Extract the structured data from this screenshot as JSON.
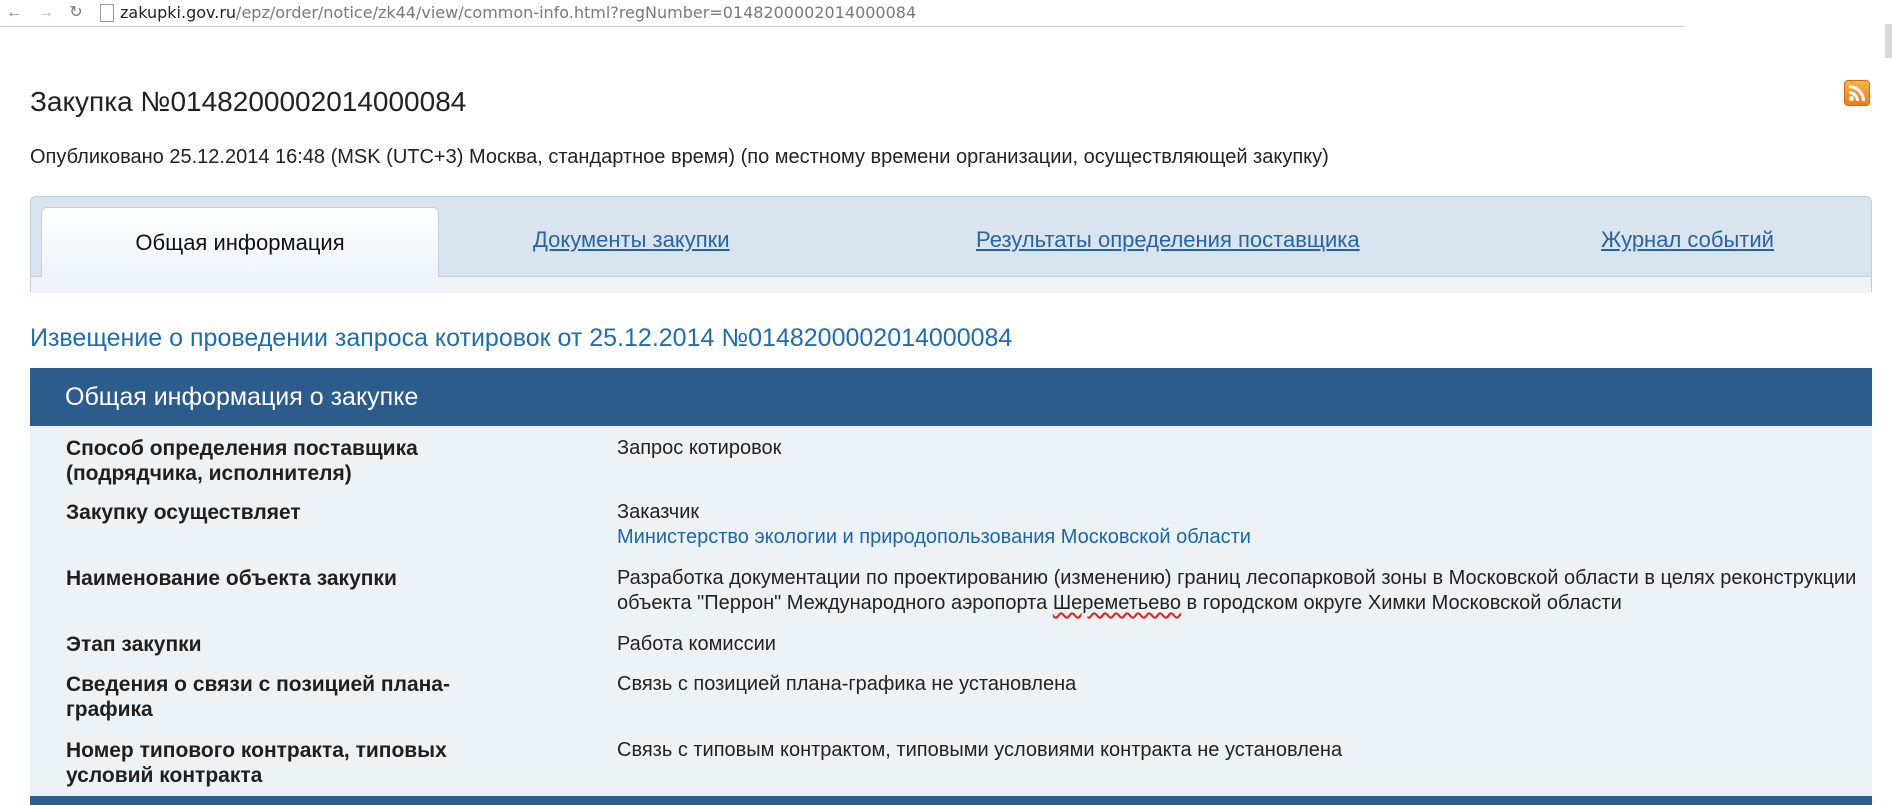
{
  "browser": {
    "back_icon": "arrow-left-icon",
    "forward_icon": "arrow-right-icon",
    "reload_icon": "reload-icon",
    "url_host": "zakupki.gov.ru",
    "url_path": "/epz/order/notice/zk44/view/common-info.html?regNumber=0148200002014000084"
  },
  "header": {
    "title": "Закупка №0148200002014000084",
    "published": "Опубликовано 25.12.2014 16:48 (MSK (UTC+3) Москва, стандартное время) (по местному времени организации, осуществляющей закупку)",
    "rss_icon": "rss-icon"
  },
  "tabs": [
    {
      "label": "Общая информация",
      "active": true
    },
    {
      "label": "Документы закупки",
      "active": false
    },
    {
      "label": "Результаты определения поставщика",
      "active": false
    },
    {
      "label": "Журнал событий",
      "active": false
    }
  ],
  "notice_heading": "Извещение о проведении запроса котировок от 25.12.2014 №0148200002014000084",
  "section": {
    "title": "Общая информация о закупке",
    "rows": [
      {
        "label": "Способ определения поставщика (подрядчика, исполнителя)",
        "value": "Запрос котировок"
      },
      {
        "label": "Закупку осуществляет",
        "value": "Заказчик",
        "link": "Министерство экологии и природопользования Московской области"
      },
      {
        "label": "Наименование объекта закупки",
        "value_part1": "Разработка документации по проектированию (изменению) границ лесопарковой зоны в Московской области в целях реконструкции объекта \"Перрон\" Международного аэропорта ",
        "value_spell": "Шереметьево",
        "value_part2": " в городском округе Химки Московской области"
      },
      {
        "label": "Этап закупки",
        "value": "Работа комиссии"
      },
      {
        "label": "Сведения о связи с позицией плана-графика",
        "value": "Связь с позицией плана-графика не установлена"
      },
      {
        "label": "Номер типового контракта, типовых условий контракта",
        "value": "Связь с типовым контрактом, типовыми условиями контракта не установлена"
      }
    ]
  },
  "colors": {
    "section_header_bg": "#2c5c8c",
    "link": "#2565a5",
    "heading": "#1c6eae",
    "section_body_bg": "#edf2f7"
  }
}
